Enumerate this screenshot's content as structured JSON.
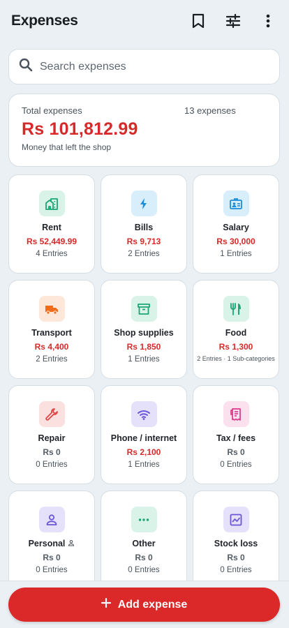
{
  "header": {
    "title": "Expenses"
  },
  "search": {
    "placeholder": "Search expenses"
  },
  "summary": {
    "label": "Total expenses",
    "count": "13 expenses",
    "amount": "Rs 101,812.99",
    "subtitle": "Money that left the shop"
  },
  "categories": [
    {
      "name": "Rent",
      "amount": "Rs 52,449.99",
      "entries": "4 Entries",
      "icon": "building-icon",
      "color": "#1aa676",
      "bg": "#d9f3e8"
    },
    {
      "name": "Bills",
      "amount": "Rs 9,713",
      "entries": "2 Entries",
      "icon": "bolt-icon",
      "color": "#1a8ed8",
      "bg": "#d8eefb"
    },
    {
      "name": "Salary",
      "amount": "Rs 30,000",
      "entries": "1 Entries",
      "icon": "id-badge-icon",
      "color": "#1a8ed8",
      "bg": "#d8eefb"
    },
    {
      "name": "Transport",
      "amount": "Rs 4,400",
      "entries": "2 Entries",
      "icon": "truck-icon",
      "color": "#ef6c1a",
      "bg": "#fde7d8"
    },
    {
      "name": "Shop supplies",
      "amount": "Rs 1,850",
      "entries": "1 Entries",
      "icon": "archive-box-icon",
      "color": "#1aa676",
      "bg": "#d9f3e8"
    },
    {
      "name": "Food",
      "amount": "Rs 1,300",
      "entries": "2 Entries · 1 Sub-categories",
      "icon": "utensils-icon",
      "color": "#1aa676",
      "bg": "#d9f3e8"
    },
    {
      "name": "Repair",
      "amount": "Rs 0",
      "entries": "0 Entries",
      "icon": "wrench-icon",
      "color": "#e04646",
      "bg": "#fbe0e0"
    },
    {
      "name": "Phone / internet",
      "amount": "Rs 2,100",
      "entries": "1 Entries",
      "icon": "wifi-icon",
      "color": "#6c55d8",
      "bg": "#e6e1fa"
    },
    {
      "name": "Tax / fees",
      "amount": "Rs 0",
      "entries": "0 Entries",
      "icon": "receipt-icon",
      "color": "#d8388a",
      "bg": "#fbe0ee"
    },
    {
      "name": "Personal",
      "amount": "Rs 0",
      "entries": "0 Entries",
      "icon": "person-icon",
      "color": "#6c55d8",
      "bg": "#e6e1fa"
    },
    {
      "name": "Other",
      "amount": "Rs 0",
      "entries": "0 Entries",
      "icon": "dots-icon",
      "color": "#1aa676",
      "bg": "#d9f3e8"
    },
    {
      "name": "Stock loss",
      "amount": "Rs 0",
      "entries": "0 Entries",
      "icon": "chart-icon",
      "color": "#6c55d8",
      "bg": "#e6e1fa"
    }
  ],
  "footer": {
    "add_label": "Add expense"
  }
}
